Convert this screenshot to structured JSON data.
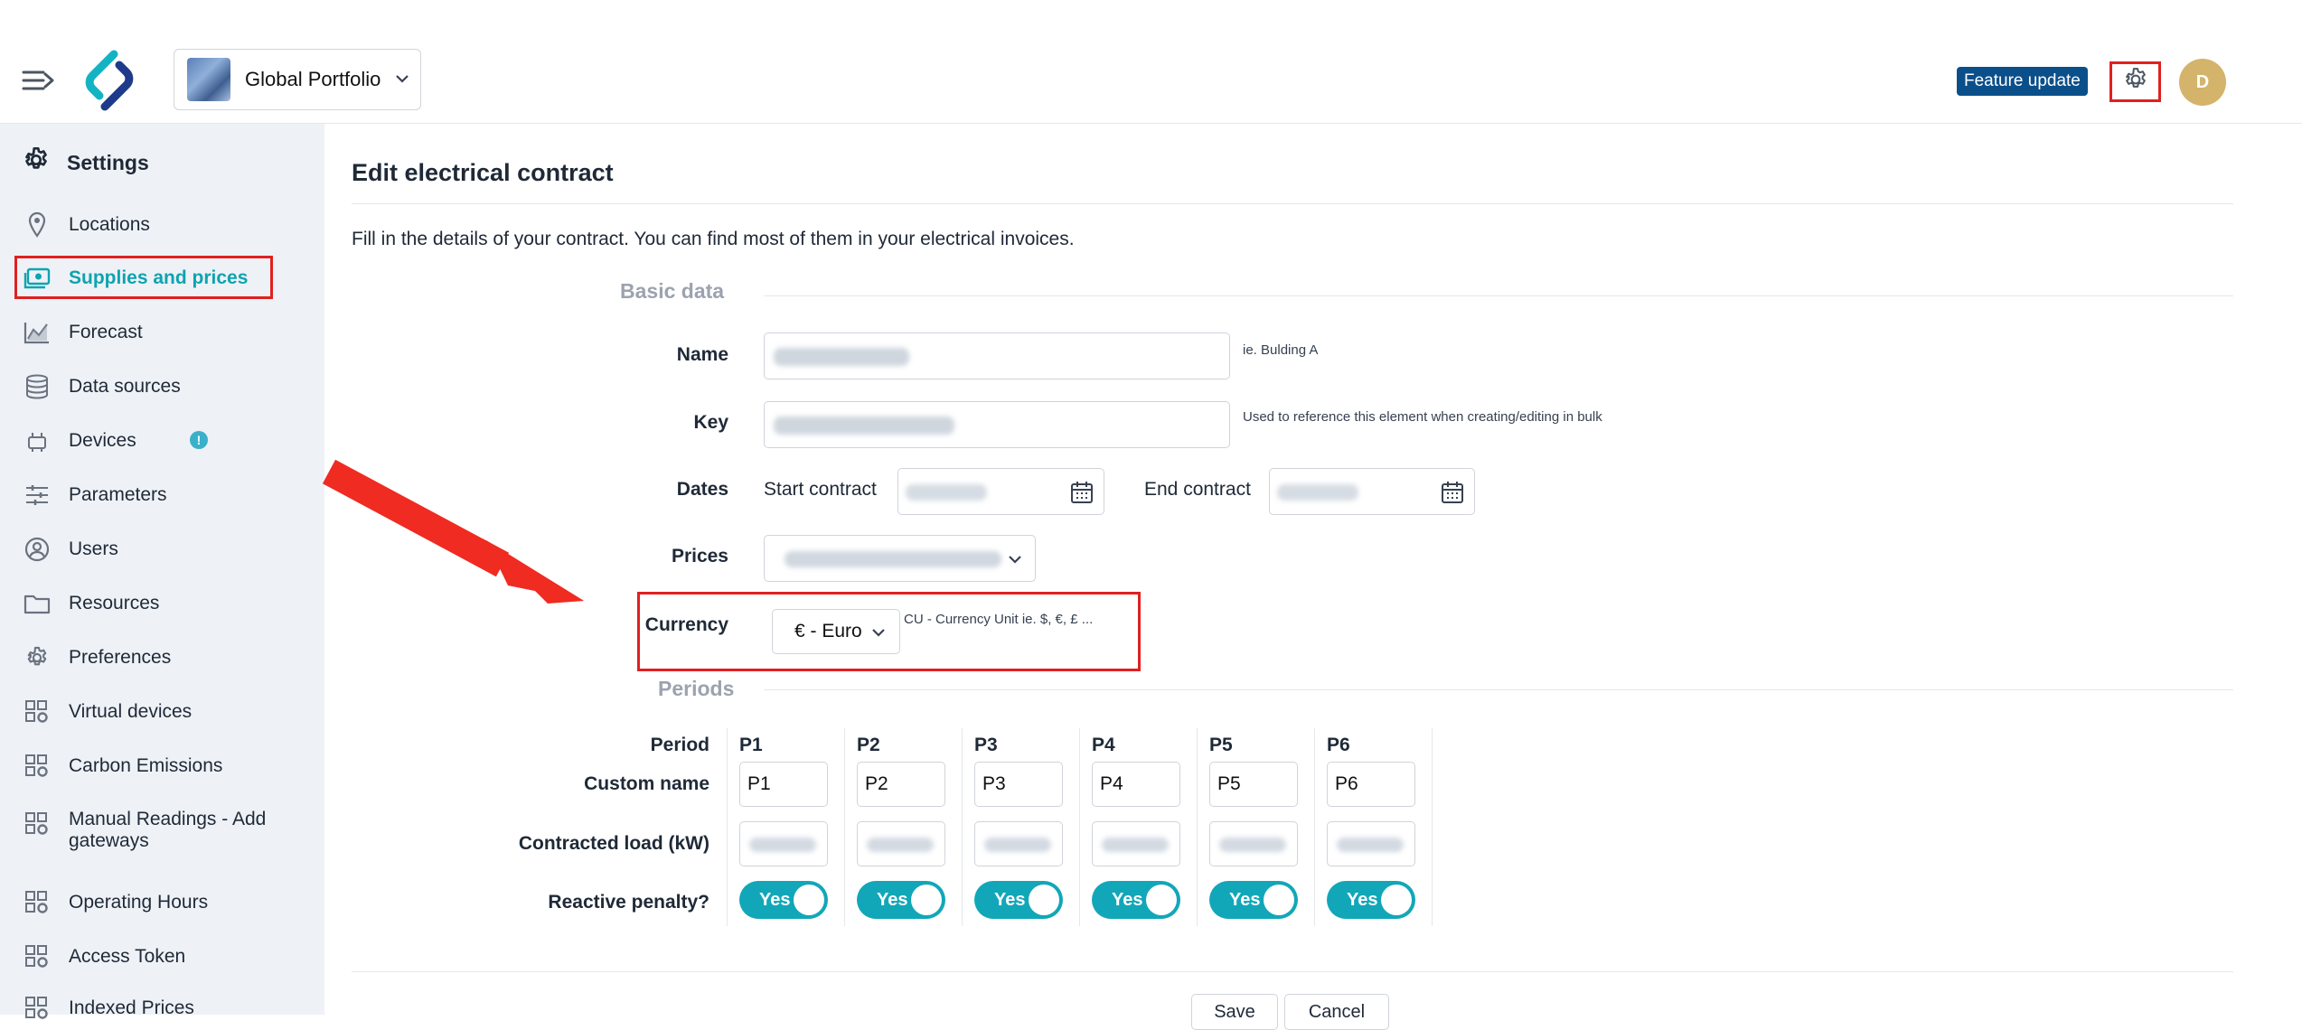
{
  "topbar": {
    "portfolio_label": "Global Portfolio",
    "feature_badge": "Feature update",
    "avatar_initial": "D"
  },
  "sidebar": {
    "title": "Settings",
    "items": [
      {
        "label": "Locations",
        "icon": "location-pin-icon"
      },
      {
        "label": "Supplies and prices",
        "icon": "supplies-icon",
        "active": true
      },
      {
        "label": "Forecast",
        "icon": "chart-icon"
      },
      {
        "label": "Data sources",
        "icon": "database-icon"
      },
      {
        "label": "Devices",
        "icon": "device-icon",
        "badge": "!"
      },
      {
        "label": "Parameters",
        "icon": "sliders-icon"
      },
      {
        "label": "Users",
        "icon": "user-circle-icon"
      },
      {
        "label": "Resources",
        "icon": "folder-icon"
      },
      {
        "label": "Preferences",
        "icon": "gear-icon"
      },
      {
        "label": "Virtual devices",
        "icon": "grid-gear-icon"
      },
      {
        "label": "Carbon Emissions",
        "icon": "grid-gear-icon"
      },
      {
        "label": "Manual Readings - Add",
        "label2": "gateways",
        "icon": "grid-gear-icon"
      },
      {
        "label": "Operating Hours",
        "icon": "grid-gear-icon"
      },
      {
        "label": "Access Token",
        "icon": "grid-gear-icon"
      },
      {
        "label": "Indexed Prices",
        "icon": "grid-gear-icon"
      }
    ]
  },
  "main": {
    "title": "Edit electrical contract",
    "intro": "Fill in the details of your contract. You can find most of them in your electrical invoices.",
    "basic_data": {
      "section_title": "Basic data",
      "name_label": "Name",
      "name_hint": "ie. Bulding A",
      "key_label": "Key",
      "key_hint": "Used to reference this element when creating/editing in bulk",
      "dates_label": "Dates",
      "start_contract": "Start contract",
      "end_contract": "End contract",
      "prices_label": "Prices",
      "currency_label": "Currency",
      "currency_value": "€ - Euro",
      "currency_hint": "CU - Currency Unit ie. $, €, £ ..."
    },
    "periods": {
      "section_title": "Periods",
      "row_labels": {
        "period": "Period",
        "custom_name": "Custom name",
        "contracted_load": "Contracted load (kW)",
        "reactive_penalty": "Reactive penalty?"
      },
      "columns": [
        {
          "head": "P1",
          "custom_name": "P1",
          "reactive": "Yes"
        },
        {
          "head": "P2",
          "custom_name": "P2",
          "reactive": "Yes"
        },
        {
          "head": "P3",
          "custom_name": "P3",
          "reactive": "Yes"
        },
        {
          "head": "P4",
          "custom_name": "P4",
          "reactive": "Yes"
        },
        {
          "head": "P5",
          "custom_name": "P5",
          "reactive": "Yes"
        },
        {
          "head": "P6",
          "custom_name": "P6",
          "reactive": "Yes"
        }
      ]
    },
    "buttons": {
      "save": "Save",
      "cancel": "Cancel"
    }
  },
  "colors": {
    "accent": "#12a7b8",
    "highlight": "#e02020",
    "badge": "#0b4f8a",
    "avatar": "#d4b36a"
  }
}
